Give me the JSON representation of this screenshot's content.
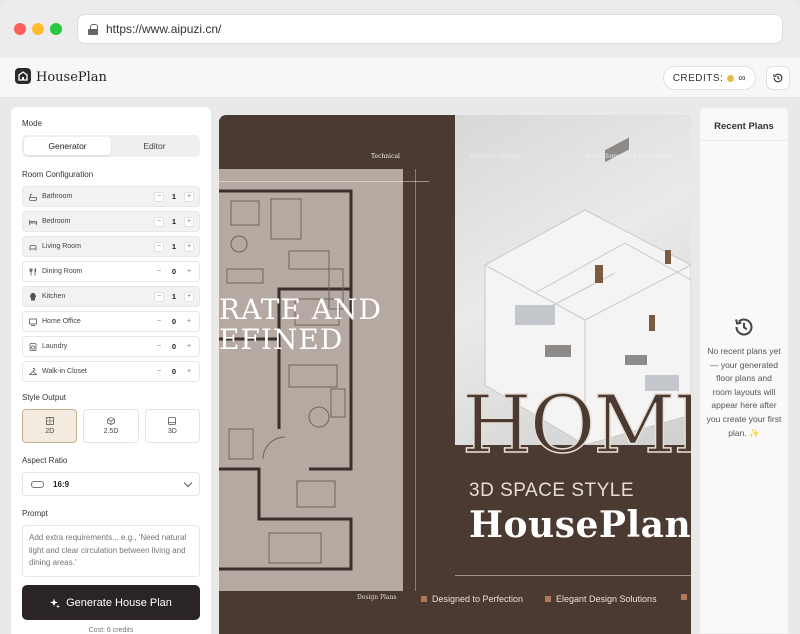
{
  "browser": {
    "url": "https://www.aipuzi.cn/"
  },
  "header": {
    "brand": "HousePlan",
    "credits_label": "CREDITS:",
    "credits_value": "∞"
  },
  "sidebar": {
    "mode_label": "Mode",
    "mode_tabs": [
      "Generator",
      "Editor"
    ],
    "room_config_label": "Room Configuration",
    "rooms": [
      {
        "name": "Bathroom",
        "value": "1",
        "icon": "bathtub-icon",
        "selected": true
      },
      {
        "name": "Bedroom",
        "value": "1",
        "icon": "bed-icon",
        "selected": true
      },
      {
        "name": "Living Room",
        "value": "1",
        "icon": "sofa-icon",
        "selected": true
      },
      {
        "name": "Dining Room",
        "value": "0",
        "icon": "cutlery-icon",
        "selected": false
      },
      {
        "name": "Kitchen",
        "value": "1",
        "icon": "chef-hat-icon",
        "selected": true
      },
      {
        "name": "Home Office",
        "value": "0",
        "icon": "desk-icon",
        "selected": false
      },
      {
        "name": "Laundry",
        "value": "0",
        "icon": "washer-icon",
        "selected": false
      },
      {
        "name": "Walk-in Closet",
        "value": "0",
        "icon": "hanger-icon",
        "selected": false
      }
    ],
    "style_output_label": "Style Output",
    "style_options": [
      "2D",
      "2.5D",
      "3D"
    ],
    "style_selected": "2D",
    "aspect_ratio_label": "Aspect Ratio",
    "aspect_ratio_value": "16:9",
    "prompt_label": "Prompt",
    "prompt_placeholder": "Add extra requirements... e.g., 'Need natural light and clear circulation between living and dining areas.'",
    "generate_label": "Generate House Plan",
    "cost_text": "Cost: 6 credits"
  },
  "preview": {
    "top_labels": [
      "Technical",
      "Excellent Design",
      "Build Home with Enthusiastic"
    ],
    "overlay_line1": "RATE AND",
    "overlay_line2": "EFINED",
    "home_text": "HOME",
    "subtitle": "3D SPACE STYLE",
    "title": "HousePlan",
    "footer_plans": "Design Plans",
    "footer_items": [
      "Designed to Perfection",
      "Elegant Design Solutions"
    ],
    "colors": {
      "background": "#4b3a31",
      "plan_panel": "#b5a9a1",
      "accent": "#b07a5a"
    }
  },
  "recent": {
    "title": "Recent Plans",
    "empty_message": "No recent plans yet — your generated floor plans and room layouts will appear here after you create your first plan. ✨"
  }
}
